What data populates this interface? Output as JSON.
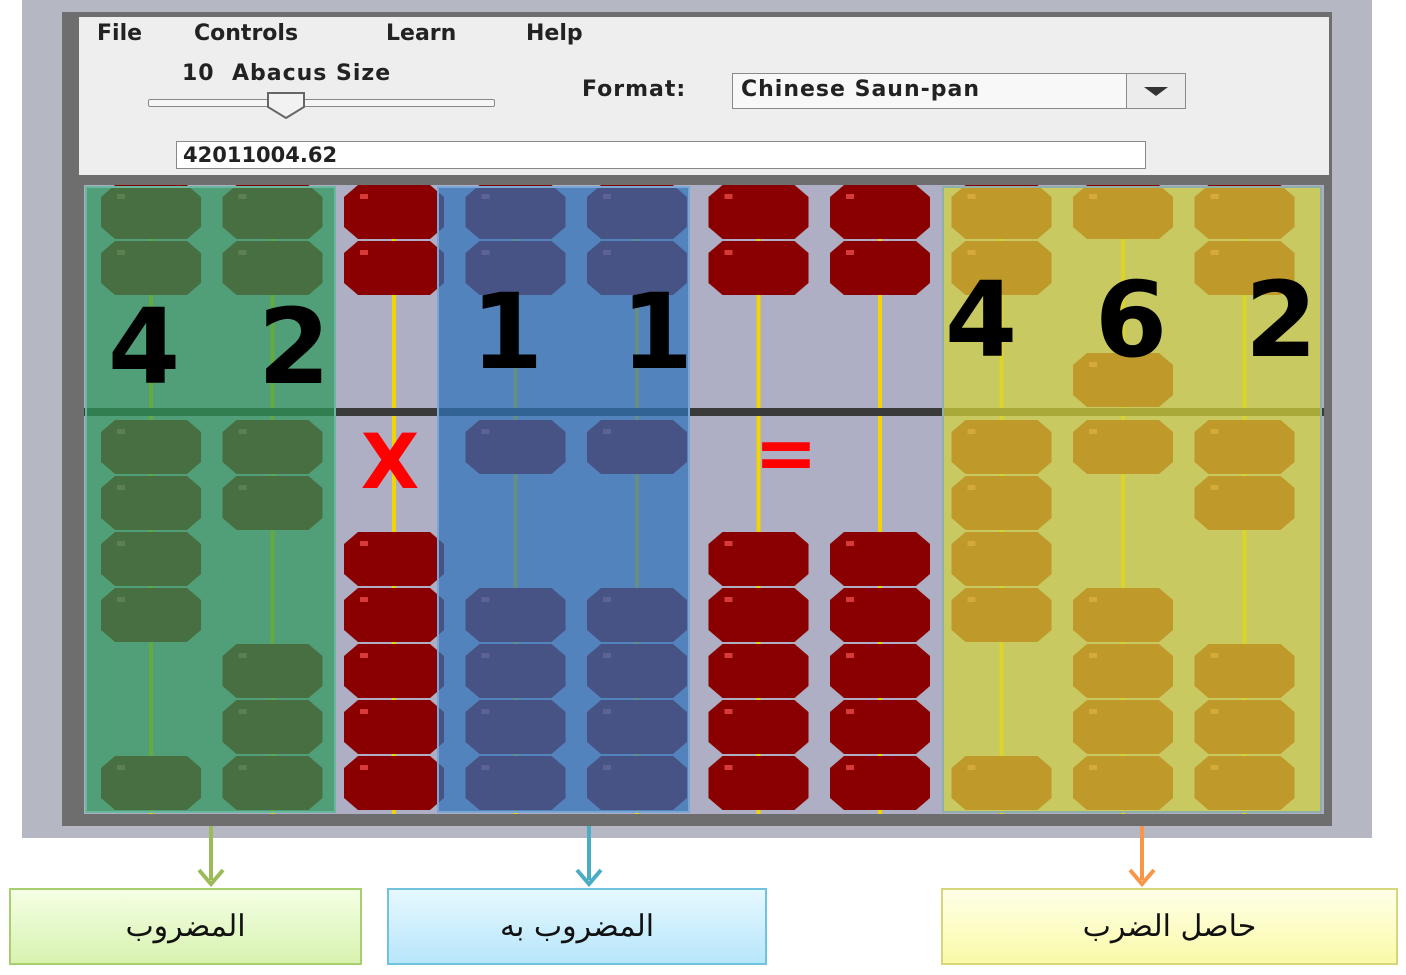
{
  "menu": [
    "File",
    "Controls",
    "Learn",
    "Help"
  ],
  "abacus_size": {
    "value": "10",
    "label": "Abacus Size",
    "slider_level_fraction": 0.38
  },
  "format": {
    "label": "Format:",
    "value": "Chinese Saun-pan"
  },
  "display_value": "42011004.62",
  "operators": {
    "multiply": "X",
    "equals": "="
  },
  "digits": {
    "multiplicand": [
      "4",
      "2"
    ],
    "multiplier": [
      "1",
      "1"
    ],
    "product": [
      "4",
      "6",
      "2"
    ]
  },
  "labels": {
    "multiplicand": "المضروب",
    "multiplier": "المضروب به",
    "product": "حاصل الضرب"
  },
  "colors": {
    "red_bead": "#8a0000",
    "green_highlight": "#2e9a5a",
    "blue_highlight": "#2f73b8",
    "yellow_highlight": "#d4d43a",
    "operator_red": "#ff0000",
    "arrow_green": "#9bbb59",
    "arrow_blue": "#4bacc6",
    "arrow_orange": "#f79646"
  },
  "rods": [
    {
      "upper": [
        0,
        1
      ],
      "lower": [
        0,
        1,
        2,
        3,
        6
      ]
    },
    {
      "upper": [
        0,
        1
      ],
      "lower": [
        0,
        1,
        4,
        5,
        6
      ]
    },
    {
      "upper": [
        0,
        1
      ],
      "lower": [
        2,
        3,
        4,
        5,
        6
      ]
    },
    {
      "upper": [
        0,
        1
      ],
      "lower": [
        0,
        3,
        4,
        5,
        6
      ]
    },
    {
      "upper": [
        0,
        1
      ],
      "lower": [
        0,
        3,
        4,
        5,
        6
      ]
    },
    {
      "upper": [
        0,
        1
      ],
      "lower": [
        2,
        3,
        4,
        5,
        6
      ]
    },
    {
      "upper": [
        0,
        1
      ],
      "lower": [
        2,
        3,
        4,
        5,
        6
      ]
    },
    {
      "upper": [
        0,
        1
      ],
      "lower": [
        0,
        1,
        2,
        3,
        6
      ]
    },
    {
      "upper": [
        0,
        3
      ],
      "lower": [
        0,
        3,
        4,
        5,
        6
      ]
    },
    {
      "upper": [
        0,
        1
      ],
      "lower": [
        0,
        1,
        4,
        5,
        6
      ]
    }
  ]
}
